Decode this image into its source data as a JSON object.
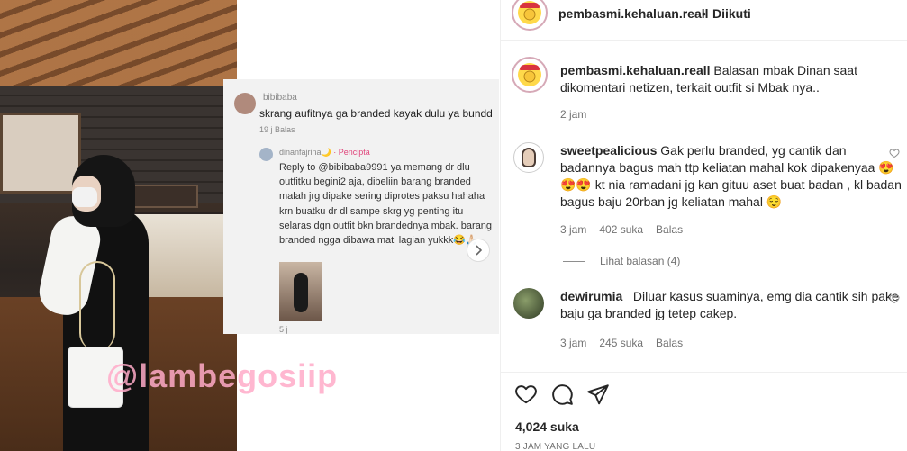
{
  "media": {
    "watermark": "@lambegosiip",
    "tiktok_comment": {
      "username": "bibibaba",
      "text": "skrang aufitnya ga branded kayak dulu ya bundd",
      "meta": "19 j   Balas",
      "reply_username": "dinanfajrina🌙",
      "reply_badge": "· Pencipta",
      "reply_text": "Reply to @bibibaba9991 ya memang dr dlu outfitku begini2 aja, dibeliin barang branded malah jrg dipake sering diprotes paksu hahaha krn buatku dr dl sampe skrg yg penting itu selaras dgn outfit bkn brandednya mbak. barang branded ngga dibawa mati lagian yukkk😂🙏🏻",
      "reply_meta": "5 j"
    },
    "next_icon": "chevron-right-icon"
  },
  "header": {
    "username": "pembasmi.kehaluan.reall",
    "separator": "•",
    "follow_status": "Diikuti"
  },
  "caption": {
    "username": "pembasmi.kehaluan.reall",
    "text": " Balasan mbak Dinan saat dikomentari netizen, terkait outfit si Mbak nya..",
    "time": "2 jam"
  },
  "comments": [
    {
      "username": "sweetpealicious",
      "text": " Gak perlu branded, yg cantik dan badannya bagus mah ttp keliatan mahal kok dipakenyaa 😍😍😍 kt nia ramadani jg kan gituu aset buat badan , kl badan bagus baju 20rban jg keliatan mahal 😌",
      "time": "3 jam",
      "likes": "402 suka",
      "reply_label": "Balas",
      "view_replies": "Lihat balasan (4)"
    },
    {
      "username": "dewirumia_",
      "text": " Diluar kasus suaminya, emg dia cantik sih pake baju ga branded jg tetep cakep.",
      "time": "3 jam",
      "likes": "245 suka",
      "reply_label": "Balas"
    }
  ],
  "actions": {
    "like_icon": "heart-icon",
    "comment_icon": "comment-icon",
    "share_icon": "paper-plane-icon"
  },
  "likes_count": "4,024 suka",
  "posted_time": "3 JAM YANG LALU"
}
